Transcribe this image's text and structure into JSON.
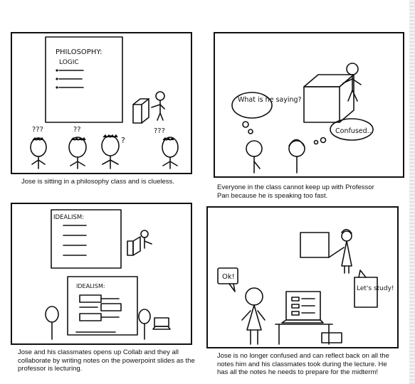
{
  "panels": [
    {
      "caption": "Jose is sitting in a philosophy class and is clueless.",
      "slide_title": "PHILOSOPHY:",
      "slide_subtitle": "LOGIC",
      "question_marks": [
        "???",
        "??",
        "?",
        "???"
      ]
    },
    {
      "caption": "Everyone in the class cannot keep up with Professor Pan because he is speaking too fast.",
      "bubble_left": "What is he saying?",
      "bubble_right": "Confused..."
    },
    {
      "caption": "Jose and his classmates opens up Collab and they all collaborate by writing notes on the powerpoint slides as the professor is lecturing.",
      "slide_title": "IDEALISM:",
      "screen_title": "IDEALISM:"
    },
    {
      "caption": "Jose is no longer confused and can reflect back on all the notes him and his classmates took during the lecture. He has all the notes he needs to prepare for the midterm!",
      "bubble_left": "Ok!",
      "bubble_right": "Let's study!"
    }
  ]
}
